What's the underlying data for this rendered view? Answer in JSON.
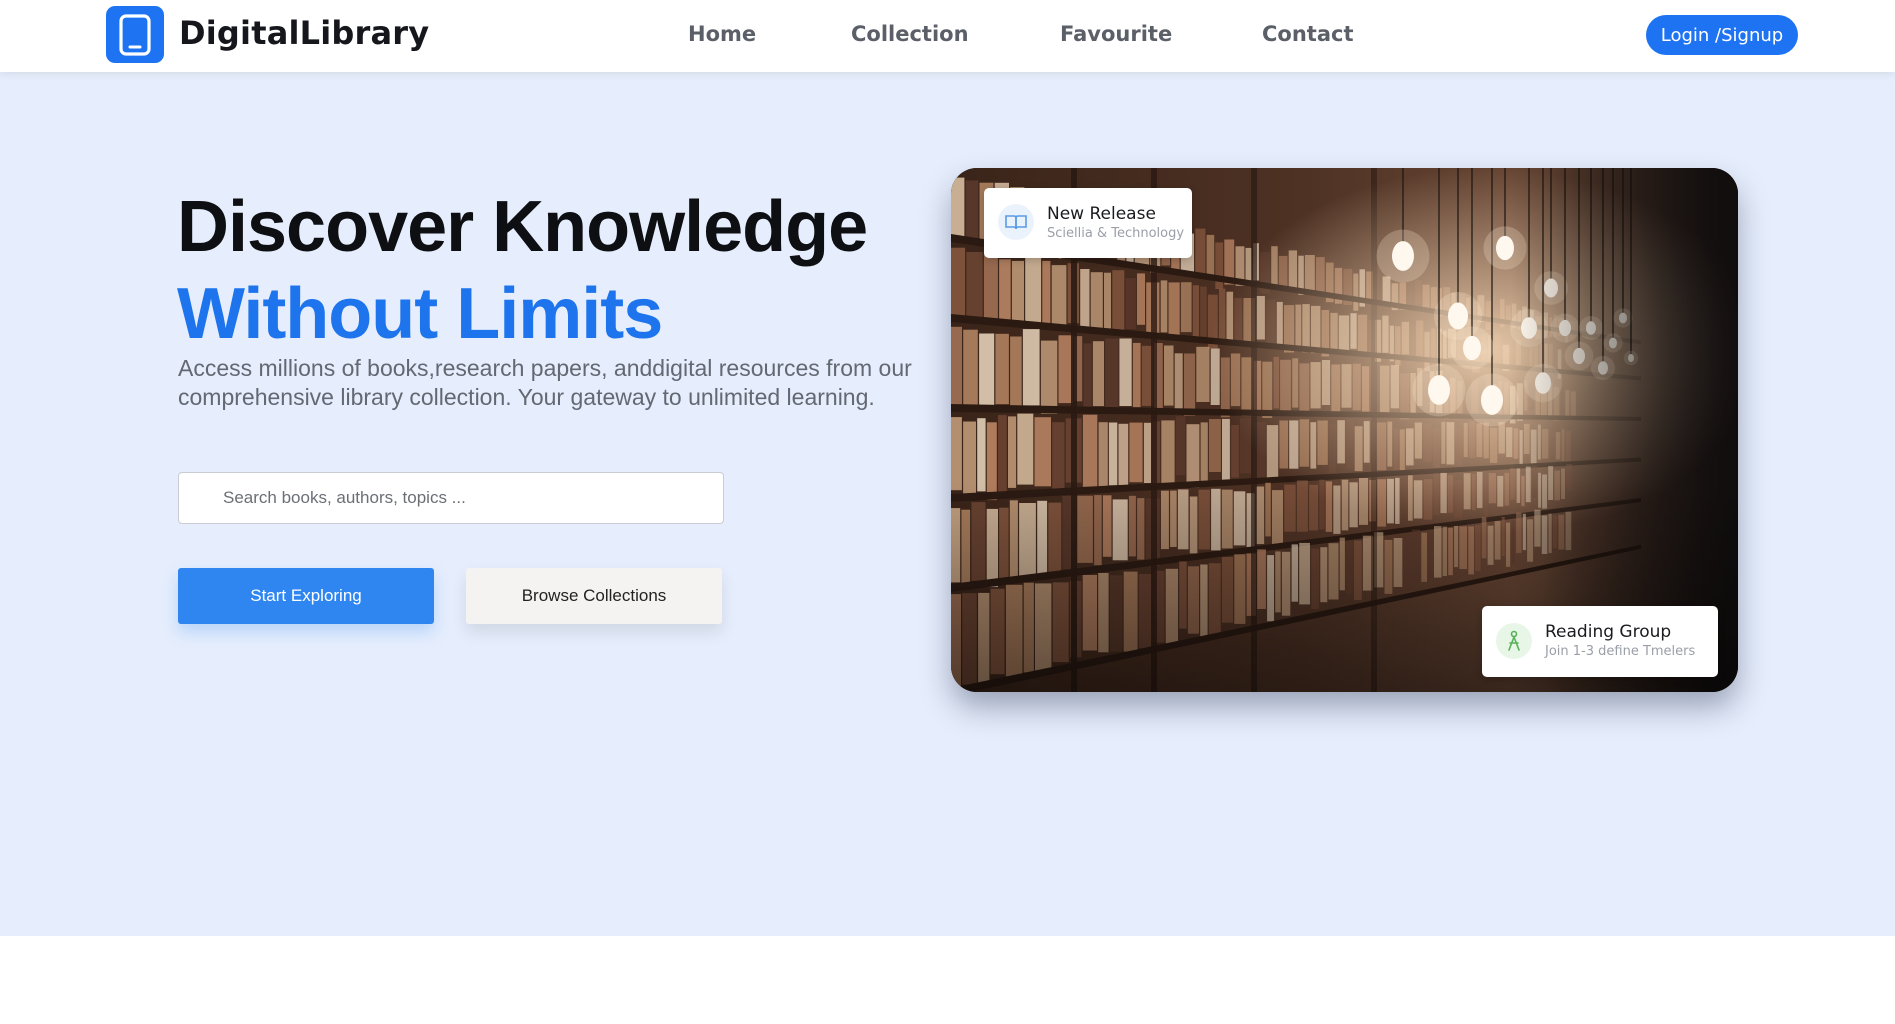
{
  "brand": {
    "name": "DigitalLibrary",
    "logo_icon": "tablet-book-icon",
    "accent": "#1e73f2"
  },
  "nav": {
    "items": [
      {
        "label": "Home"
      },
      {
        "label": "Collection"
      },
      {
        "label": "Favourite"
      },
      {
        "label": "Contact"
      }
    ],
    "login_label": "Login /Signup"
  },
  "hero": {
    "headline_line1": "Discover Knowledge",
    "headline_line2": "Without Limits",
    "subtitle": "Access millions of books,research papers, anddigital resources from our comprehensive library collection. Your gateway to unlimited learning.",
    "search": {
      "placeholder": "Search books, authors, topics ...",
      "value": ""
    },
    "primary_button": "Start Exploring",
    "secondary_button": "Browse Collections",
    "background": "#e6eefd"
  },
  "cards": {
    "new_release": {
      "title": "New Release",
      "subtitle": "Sciellia & Technology",
      "icon": "open-book-icon"
    },
    "reading_group": {
      "title": "Reading Group",
      "subtitle": "Join 1-3 define Tmelers",
      "icon": "people-icon"
    }
  }
}
